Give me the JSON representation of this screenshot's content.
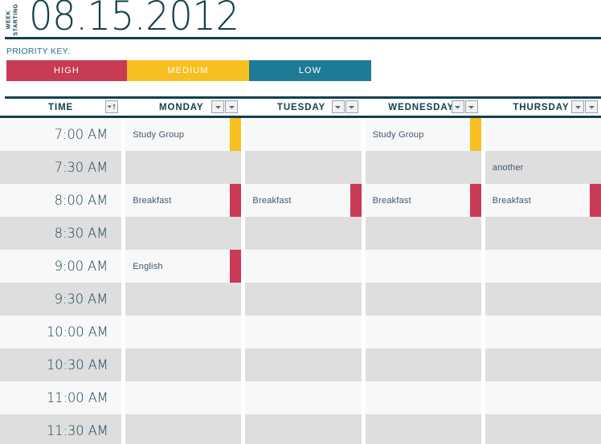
{
  "header": {
    "week_starting_line1": "WEEK",
    "week_starting_line2": "STARTING",
    "date": "08.15.2012"
  },
  "priority_key": {
    "label": "PRIORITY KEY:",
    "bands": [
      {
        "label": "HIGH",
        "color": "#c93a55",
        "key": "high"
      },
      {
        "label": "MEDIUM",
        "color": "#f8c01f",
        "key": "medium"
      },
      {
        "label": "LOW",
        "color": "#1f7a96",
        "key": "low"
      }
    ]
  },
  "colors": {
    "navy": "#13404f",
    "high": "#c93a55",
    "medium": "#f8c01f",
    "low": "#1f7a96",
    "row_light": "#f8f8f8",
    "row_dark": "#dededf"
  },
  "columns": [
    {
      "label": "TIME",
      "filters": 1
    },
    {
      "label": "MONDAY",
      "filters": 2
    },
    {
      "label": "TUESDAY",
      "filters": 2
    },
    {
      "label": "WEDNESDAY",
      "filters": 2
    },
    {
      "label": "THURSDAY",
      "filters": 2
    }
  ],
  "times": [
    "7:00 AM",
    "7:30 AM",
    "8:00 AM",
    "8:30 AM",
    "9:00 AM",
    "9:30 AM",
    "10:00 AM",
    "10:30 AM",
    "11:00 AM",
    "11:30 AM"
  ],
  "events": {
    "monday": {
      "7:00 AM": {
        "title": "Study Group",
        "priority": "medium"
      },
      "8:00 AM": {
        "title": "Breakfast",
        "priority": "high"
      },
      "9:00 AM": {
        "title": "English",
        "priority": "high"
      }
    },
    "tuesday": {
      "8:00 AM": {
        "title": "Breakfast",
        "priority": "high"
      }
    },
    "wednesday": {
      "7:00 AM": {
        "title": "Study Group",
        "priority": "medium"
      },
      "8:00 AM": {
        "title": "Breakfast",
        "priority": "high"
      }
    },
    "thursday": {
      "7:30 AM": {
        "title": "another",
        "priority": "none"
      },
      "8:00 AM": {
        "title": "Breakfast",
        "priority": "high"
      }
    }
  }
}
